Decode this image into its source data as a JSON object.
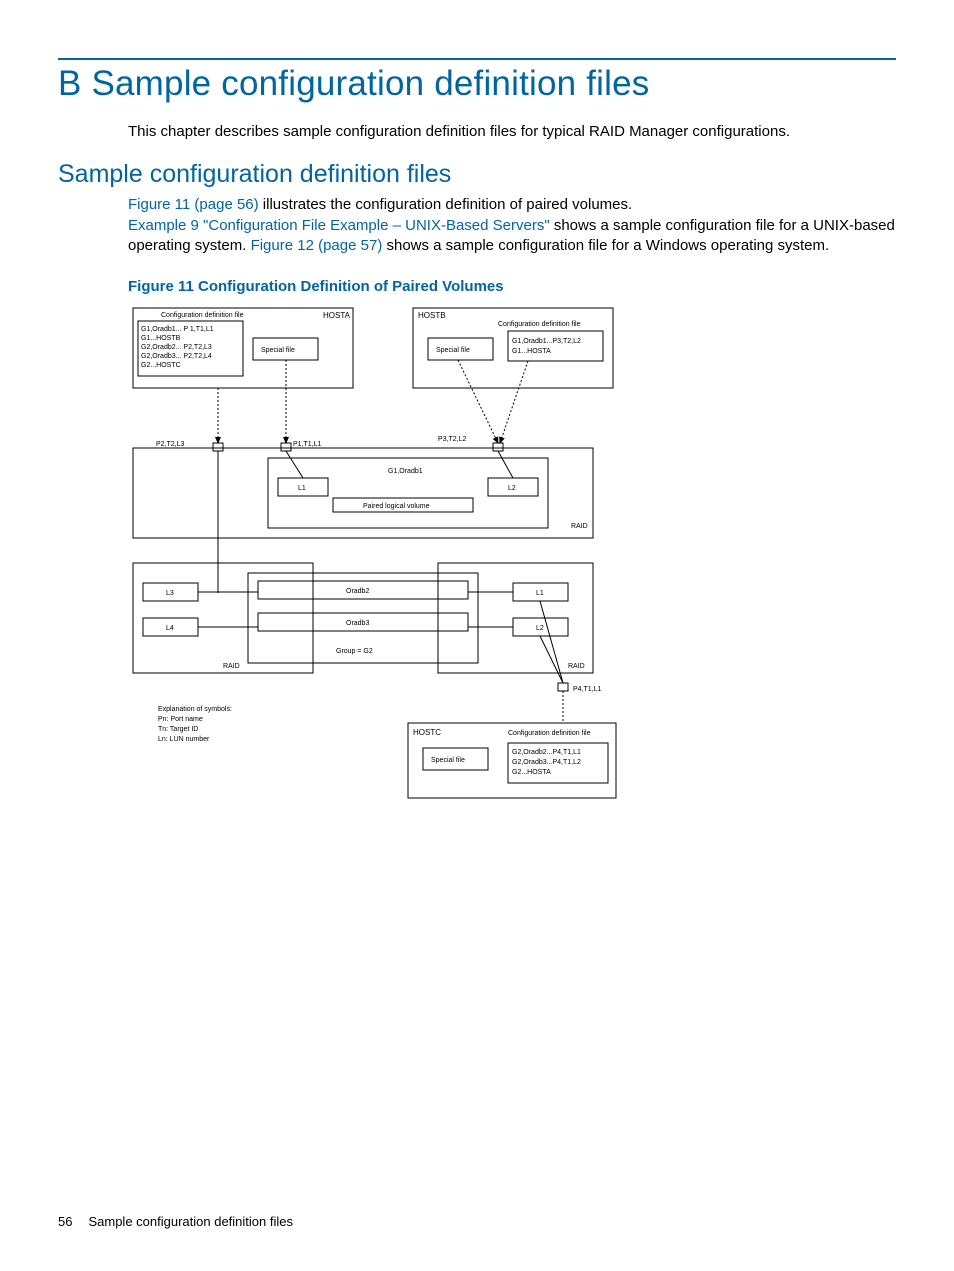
{
  "heading": "B Sample configuration definition files",
  "intro": "This chapter describes sample configuration definition files for typical RAID Manager configurations.",
  "section": "Sample configuration definition files",
  "para_frag1_link": "Figure 11 (page 56)",
  "para_frag1_after": " illustrates the configuration definition of paired volumes.",
  "para_frag2_link": "Example 9 \"Configuration File Example – UNIX-Based Servers\"",
  "para_frag2_after": " shows a sample configuration file for a UNIX-based operating system. ",
  "para_frag3_link": "Figure 12 (page 57)",
  "para_frag3_after": " shows a sample configuration file for a Windows operating system.",
  "figcaption": "Figure 11 Configuration Definition of Paired Volumes",
  "chart_data": {
    "type": "diagram",
    "hosts": {
      "HOSTA": {
        "config_label": "Configuration definition file",
        "config_lines": [
          "G1,Oradb1... P 1,T1,L1",
          "G1...HOSTB",
          "G2,Oradb2... P2,T2,L3",
          "G2,Oradb3... P2,T2,L4",
          "G2...HOSTC"
        ],
        "special_file": "Special file"
      },
      "HOSTB": {
        "config_label": "Configuration definition file",
        "config_lines": [
          "G1,Oradb1...P3,T2,L2",
          "G1...HOSTA"
        ],
        "special_file": "Special file"
      },
      "HOSTC": {
        "config_label": "Configuration definition file",
        "config_lines": [
          "G2,Oradb2...P4,T1,L1",
          "G2,Oradb3...P4,T1,L2",
          "G2...HOSTA"
        ],
        "special_file": "Special file"
      }
    },
    "ports": {
      "from_hosta_a": "P2,T2,L3",
      "from_hosta_b": "P1,T1,L1",
      "from_hostb": "P3,T2,L2",
      "from_hostc": "P4,T1,L1"
    },
    "raid_top": {
      "label_right": "RAID",
      "group_label": "G1,Oradb1",
      "pair_label": "Paired logical volume",
      "luns": [
        "L1",
        "L2"
      ]
    },
    "raid_bottom_left": {
      "label": "RAID",
      "luns": [
        "L3",
        "L4"
      ]
    },
    "raid_bottom_right": {
      "label": "RAID",
      "luns": [
        "L1",
        "L2"
      ]
    },
    "group_box": {
      "rows": [
        "Oradb2",
        "Oradb3"
      ],
      "label": "Group = G2"
    },
    "legend": {
      "title": "Explanation of symbols:",
      "lines": [
        "Pn: Port name",
        "Tn: Target ID",
        "Ln: LUN number"
      ]
    }
  },
  "footer": {
    "pageno": "56",
    "title": "Sample configuration definition files"
  }
}
